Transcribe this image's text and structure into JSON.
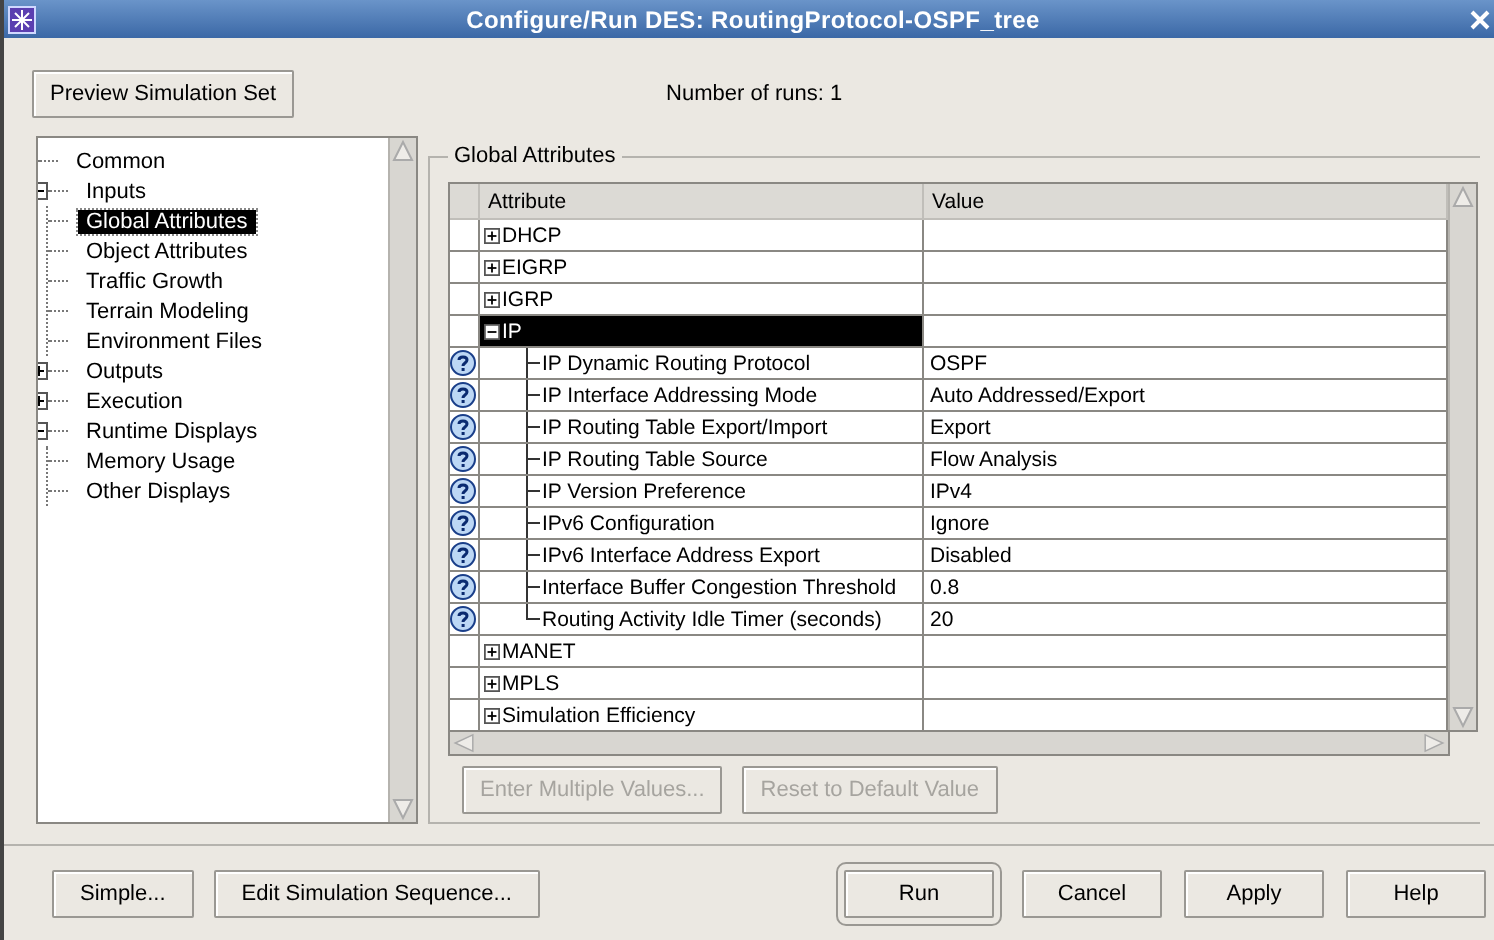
{
  "window": {
    "title": "Configure/Run DES: RoutingProtocol-OSPF_tree"
  },
  "preview_button": {
    "label": "Preview Simulation Set"
  },
  "runs_label": "Number of runs: 1",
  "tree": {
    "items": [
      {
        "label": "Common",
        "selected": false
      },
      {
        "label": "Inputs",
        "selected": false,
        "expanded": true,
        "children": [
          {
            "label": "Global Attributes",
            "selected": true
          },
          {
            "label": "Object Attributes",
            "selected": false
          },
          {
            "label": "Traffic Growth",
            "selected": false
          },
          {
            "label": "Terrain Modeling",
            "selected": false
          },
          {
            "label": "Environment Files",
            "selected": false
          }
        ]
      },
      {
        "label": "Outputs",
        "selected": false,
        "expanded": false
      },
      {
        "label": "Execution",
        "selected": false,
        "expanded": false
      },
      {
        "label": "Runtime Displays",
        "selected": false,
        "expanded": true,
        "children": [
          {
            "label": "Memory Usage",
            "selected": false
          },
          {
            "label": "Other Displays",
            "selected": false
          }
        ]
      }
    ]
  },
  "group": {
    "title": "Global Attributes",
    "table": {
      "columns": [
        "Attribute",
        "Value"
      ],
      "rows": [
        {
          "label": "DHCP",
          "expanded": false,
          "selected": false
        },
        {
          "label": "EIGRP",
          "expanded": false,
          "selected": false
        },
        {
          "label": "IGRP",
          "expanded": false,
          "selected": false
        },
        {
          "label": "IP",
          "expanded": true,
          "selected": true,
          "children": [
            {
              "label": "IP Dynamic Routing Protocol",
              "value": "OSPF"
            },
            {
              "label": "IP Interface Addressing Mode",
              "value": "Auto Addressed/Export"
            },
            {
              "label": "IP Routing Table Export/Import",
              "value": "Export"
            },
            {
              "label": "IP Routing Table Source",
              "value": "Flow Analysis"
            },
            {
              "label": "IP Version Preference",
              "value": "IPv4"
            },
            {
              "label": "IPv6 Configuration",
              "value": "Ignore"
            },
            {
              "label": "IPv6 Interface Address Export",
              "value": "Disabled"
            },
            {
              "label": "Interface Buffer Congestion Threshold",
              "value": "0.8"
            },
            {
              "label": "Routing Activity Idle Timer (seconds)",
              "value": "20"
            }
          ]
        },
        {
          "label": "MANET",
          "expanded": false,
          "selected": false
        },
        {
          "label": "MPLS",
          "expanded": false,
          "selected": false
        },
        {
          "label": "Simulation Efficiency",
          "expanded": false,
          "selected": false
        }
      ]
    },
    "buttons": [
      {
        "label": "Enter Multiple Values...",
        "disabled": true
      },
      {
        "label": "Reset to Default Value",
        "disabled": true
      }
    ]
  },
  "left_buttons": [
    {
      "label": "Simple..."
    },
    {
      "label": "Edit Simulation Sequence..."
    }
  ],
  "right_buttons": [
    {
      "label": "Run",
      "default": true
    },
    {
      "label": "Cancel",
      "default": false
    },
    {
      "label": "Apply",
      "default": false
    },
    {
      "label": "Help",
      "default": false
    }
  ]
}
